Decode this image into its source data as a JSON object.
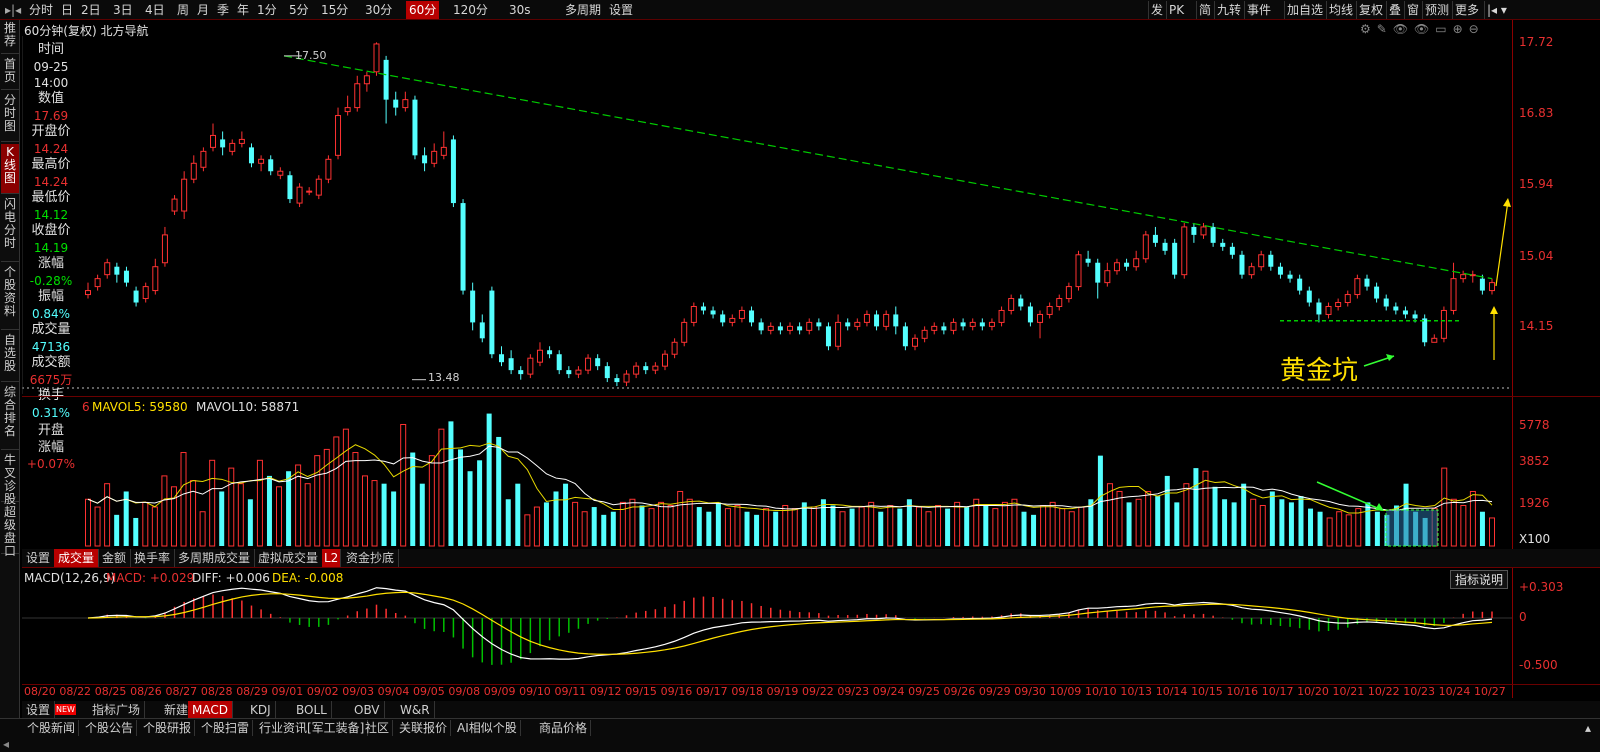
{
  "toolbar": {
    "periods": [
      "分时",
      "日",
      "2日",
      "3日",
      "4日",
      "周",
      "月",
      "季",
      "年",
      "1分",
      "5分",
      "15分",
      "30分",
      "60分",
      "120分",
      "30s",
      "多周期",
      "设置"
    ],
    "selected_period": "60分",
    "right_buttons": [
      "发",
      "PK",
      "简",
      "九转",
      "事件",
      "加自选",
      "均线",
      "复权",
      "叠",
      "窗",
      "预测",
      "更多"
    ]
  },
  "sidebar": {
    "tabs": [
      "推荐",
      "首页",
      "分时图",
      "K线图",
      "闪电分时",
      "个股资料",
      "自选股",
      "综合排名",
      "牛叉诊股",
      "超级盘口"
    ],
    "selected": "K线图"
  },
  "chart_title": "60分钟(复权)  北方导航",
  "info_panel": [
    {
      "label": "时间",
      "value": "09-25"
    },
    {
      "label": "",
      "value": "14:00"
    },
    {
      "label": "数值",
      "value": "17.69"
    },
    {
      "label": "开盘价",
      "value": "14.24"
    },
    {
      "label": "最高价",
      "value": "14.24"
    },
    {
      "label": "最低价",
      "value": "14.12"
    },
    {
      "label": "收盘价",
      "value": "14.19"
    },
    {
      "label": "涨幅",
      "value": "-0.28%"
    },
    {
      "label": "振幅",
      "value": "0.84%"
    },
    {
      "label": "成交量",
      "value": "47136"
    },
    {
      "label": "成交额",
      "value": "6675万"
    },
    {
      "label": "换手",
      "value": "0.31%"
    },
    {
      "label": "开盘涨幅",
      "value": "+0.07%"
    }
  ],
  "price_axis": [
    "17.72",
    "16.83",
    "15.94",
    "15.04",
    "14.15"
  ],
  "annotations": {
    "high": "17.50",
    "low": "13.48",
    "pattern_label": "黄金坑"
  },
  "volume": {
    "legend_prefix": "6",
    "mavol5": "MAVOL5: 59580",
    "mavol10": "MAVOL10: 58871",
    "axis": [
      "5778",
      "3852",
      "1926",
      "X100"
    ],
    "tabs": [
      "设置",
      "成交量",
      "金额",
      "换手率",
      "多周期成交量",
      "虚拟成交量",
      "L2",
      "资金抄底"
    ],
    "selected_tab": "成交量"
  },
  "macd": {
    "name": "MACD(12,26,9)",
    "macd": "MACD: +0.029",
    "diff": "DIFF: +0.006",
    "dea": "DEA: -0.008",
    "axis": [
      "+0.303",
      "0",
      "-0.500"
    ],
    "help": "指标说明"
  },
  "dates": [
    "08/20",
    "08/22",
    "08/25",
    "08/26",
    "08/27",
    "08/28",
    "08/29",
    "09/01",
    "09/02",
    "09/03",
    "09/04",
    "09/05",
    "09/08",
    "09/09",
    "09/10",
    "09/11",
    "09/12",
    "09/15",
    "09/16",
    "09/17",
    "09/18",
    "09/19",
    "09/22",
    "09/23",
    "09/24",
    "09/25",
    "09/26",
    "09/29",
    "09/30",
    "10/09",
    "10/10",
    "10/13",
    "10/14",
    "10/15",
    "10/16",
    "10/17",
    "10/20",
    "10/21",
    "10/22",
    "10/23",
    "10/24",
    "10/27"
  ],
  "indicator_tabs": [
    "设置",
    "指标广场",
    "新建",
    "MACD",
    "KDJ",
    "BOLL",
    "OBV",
    "W&R"
  ],
  "indicator_new_badge": "NEW",
  "indicator_selected": "MACD",
  "footer_tabs": [
    "个股新闻",
    "个股公告",
    "个股研报",
    "个股扫雷",
    "行业资讯[军工装备]",
    "社区",
    "关联报价",
    "AI相似个股",
    "商品价格"
  ],
  "colors": {
    "up": "#ff3232",
    "down": "#54ffff",
    "trend": "#00cc00",
    "pattern": "#ffe000",
    "ma_white": "#ffffff",
    "ma_yellow": "#e6d800",
    "axis": "#e83030"
  },
  "chart_data": {
    "type": "candlestick",
    "interval": "60分",
    "ylim": [
      13.3,
      17.8
    ],
    "y_ticks": [
      17.72,
      16.83,
      15.94,
      15.04,
      14.15
    ],
    "candles": [
      [
        14.55,
        14.6,
        14.7,
        14.5
      ],
      [
        14.65,
        14.75,
        14.8,
        14.6
      ],
      [
        14.8,
        14.95,
        15.0,
        14.75
      ],
      [
        14.9,
        14.8,
        14.95,
        14.7
      ],
      [
        14.85,
        14.7,
        14.9,
        14.65
      ],
      [
        14.6,
        14.45,
        14.65,
        14.4
      ],
      [
        14.5,
        14.65,
        14.7,
        14.45
      ],
      [
        14.6,
        14.9,
        15.0,
        14.55
      ],
      [
        14.95,
        15.3,
        15.4,
        14.9
      ],
      [
        15.6,
        15.75,
        15.8,
        15.55
      ],
      [
        15.6,
        16.0,
        16.1,
        15.5
      ],
      [
        16.0,
        16.2,
        16.3,
        15.95
      ],
      [
        16.15,
        16.35,
        16.4,
        16.1
      ],
      [
        16.4,
        16.55,
        16.7,
        16.35
      ],
      [
        16.5,
        16.4,
        16.6,
        16.3
      ],
      [
        16.35,
        16.45,
        16.5,
        16.3
      ],
      [
        16.45,
        16.5,
        16.6,
        16.4
      ],
      [
        16.4,
        16.2,
        16.45,
        16.15
      ],
      [
        16.2,
        16.25,
        16.3,
        16.1
      ],
      [
        16.25,
        16.1,
        16.3,
        16.05
      ],
      [
        16.05,
        16.1,
        16.15,
        16.0
      ],
      [
        16.05,
        15.75,
        16.1,
        15.7
      ],
      [
        15.7,
        15.9,
        15.95,
        15.65
      ],
      [
        15.85,
        15.85,
        15.9,
        15.8
      ],
      [
        15.8,
        16.0,
        16.05,
        15.75
      ],
      [
        16.0,
        16.25,
        16.3,
        15.95
      ],
      [
        16.3,
        16.8,
        16.9,
        16.25
      ],
      [
        16.85,
        16.9,
        17.05,
        16.8
      ],
      [
        16.9,
        17.2,
        17.3,
        16.85
      ],
      [
        17.2,
        17.3,
        17.35,
        17.1
      ],
      [
        17.35,
        17.7,
        17.72,
        17.3
      ],
      [
        17.5,
        17.0,
        17.55,
        16.7
      ],
      [
        17.0,
        16.9,
        17.1,
        16.8
      ],
      [
        16.9,
        17.0,
        17.1,
        16.85
      ],
      [
        17.0,
        16.3,
        17.05,
        16.25
      ],
      [
        16.3,
        16.2,
        16.4,
        16.1
      ],
      [
        16.2,
        16.35,
        16.45,
        16.15
      ],
      [
        16.3,
        16.4,
        16.6,
        16.25
      ],
      [
        16.5,
        15.7,
        16.55,
        15.65
      ],
      [
        15.7,
        14.6,
        15.75,
        14.55
      ],
      [
        14.6,
        14.2,
        14.7,
        14.1
      ],
      [
        14.2,
        14.0,
        14.3,
        13.95
      ],
      [
        14.6,
        13.8,
        14.65,
        13.75
      ],
      [
        13.8,
        13.7,
        13.9,
        13.65
      ],
      [
        13.75,
        13.6,
        13.85,
        13.55
      ],
      [
        13.6,
        13.55,
        13.65,
        13.48
      ],
      [
        13.55,
        13.75,
        13.8,
        13.5
      ],
      [
        13.7,
        13.85,
        13.95,
        13.65
      ],
      [
        13.85,
        13.8,
        13.9,
        13.75
      ],
      [
        13.8,
        13.6,
        13.85,
        13.55
      ],
      [
        13.6,
        13.55,
        13.65,
        13.5
      ],
      [
        13.55,
        13.6,
        13.65,
        13.5
      ],
      [
        13.6,
        13.75,
        13.8,
        13.55
      ],
      [
        13.75,
        13.65,
        13.8,
        13.6
      ],
      [
        13.65,
        13.5,
        13.7,
        13.45
      ],
      [
        13.5,
        13.45,
        13.55,
        13.4
      ],
      [
        13.45,
        13.55,
        13.6,
        13.4
      ],
      [
        13.55,
        13.65,
        13.7,
        13.5
      ],
      [
        13.65,
        13.6,
        13.7,
        13.55
      ],
      [
        13.6,
        13.65,
        13.7,
        13.55
      ],
      [
        13.65,
        13.8,
        13.85,
        13.6
      ],
      [
        13.8,
        13.95,
        14.0,
        13.75
      ],
      [
        13.95,
        14.2,
        14.25,
        13.9
      ],
      [
        14.2,
        14.4,
        14.45,
        14.15
      ],
      [
        14.4,
        14.35,
        14.45,
        14.3
      ],
      [
        14.35,
        14.3,
        14.4,
        14.25
      ],
      [
        14.3,
        14.2,
        14.35,
        14.15
      ],
      [
        14.2,
        14.25,
        14.3,
        14.15
      ],
      [
        14.25,
        14.35,
        14.4,
        14.2
      ],
      [
        14.35,
        14.2,
        14.4,
        14.15
      ],
      [
        14.2,
        14.1,
        14.25,
        14.05
      ],
      [
        14.1,
        14.15,
        14.2,
        14.05
      ],
      [
        14.15,
        14.1,
        14.2,
        14.05
      ],
      [
        14.1,
        14.15,
        14.2,
        14.05
      ],
      [
        14.15,
        14.1,
        14.2,
        14.05
      ],
      [
        14.1,
        14.2,
        14.25,
        14.05
      ],
      [
        14.2,
        14.15,
        14.25,
        14.1
      ],
      [
        14.15,
        13.9,
        14.2,
        13.85
      ],
      [
        13.9,
        14.2,
        14.3,
        13.85
      ],
      [
        14.2,
        14.15,
        14.25,
        14.1
      ],
      [
        14.15,
        14.2,
        14.25,
        14.1
      ],
      [
        14.2,
        14.3,
        14.35,
        14.15
      ],
      [
        14.3,
        14.15,
        14.35,
        14.1
      ],
      [
        14.15,
        14.3,
        14.35,
        14.1
      ],
      [
        14.3,
        14.15,
        14.4,
        14.05
      ],
      [
        14.15,
        13.9,
        14.2,
        13.85
      ],
      [
        13.9,
        14.0,
        14.05,
        13.85
      ],
      [
        14.0,
        14.1,
        14.15,
        13.95
      ],
      [
        14.1,
        14.15,
        14.2,
        14.05
      ],
      [
        14.15,
        14.1,
        14.2,
        14.05
      ],
      [
        14.1,
        14.2,
        14.25,
        14.05
      ],
      [
        14.2,
        14.15,
        14.25,
        14.1
      ],
      [
        14.15,
        14.2,
        14.25,
        14.1
      ],
      [
        14.2,
        14.15,
        14.25,
        14.1
      ],
      [
        14.15,
        14.2,
        14.25,
        14.1
      ],
      [
        14.2,
        14.35,
        14.4,
        14.15
      ],
      [
        14.35,
        14.5,
        14.55,
        14.3
      ],
      [
        14.5,
        14.4,
        14.55,
        14.35
      ],
      [
        14.4,
        14.2,
        14.45,
        14.15
      ],
      [
        14.2,
        14.3,
        14.35,
        14.0
      ],
      [
        14.3,
        14.4,
        14.45,
        14.25
      ],
      [
        14.4,
        14.5,
        14.55,
        14.35
      ],
      [
        14.5,
        14.65,
        14.7,
        14.45
      ],
      [
        14.65,
        15.05,
        15.1,
        14.6
      ],
      [
        15.0,
        14.95,
        15.1,
        14.9
      ],
      [
        14.95,
        14.7,
        15.0,
        14.5
      ],
      [
        14.7,
        14.85,
        14.95,
        14.65
      ],
      [
        14.85,
        14.95,
        15.0,
        14.8
      ],
      [
        14.95,
        14.9,
        15.0,
        14.85
      ],
      [
        14.9,
        15.0,
        15.1,
        14.85
      ],
      [
        15.0,
        15.3,
        15.35,
        14.95
      ],
      [
        15.3,
        15.2,
        15.4,
        15.15
      ],
      [
        15.2,
        15.1,
        15.25,
        15.05
      ],
      [
        15.2,
        14.8,
        15.25,
        14.75
      ],
      [
        14.8,
        15.4,
        15.45,
        14.75
      ],
      [
        15.4,
        15.3,
        15.45,
        15.2
      ],
      [
        15.3,
        15.4,
        15.45,
        15.25
      ],
      [
        15.4,
        15.2,
        15.45,
        15.15
      ],
      [
        15.2,
        15.15,
        15.25,
        15.1
      ],
      [
        15.15,
        15.05,
        15.2,
        15.0
      ],
      [
        15.05,
        14.8,
        15.1,
        14.75
      ],
      [
        14.8,
        14.9,
        14.95,
        14.75
      ],
      [
        14.9,
        15.05,
        15.1,
        14.85
      ],
      [
        15.05,
        14.9,
        15.1,
        14.85
      ],
      [
        14.9,
        14.8,
        14.95,
        14.75
      ],
      [
        14.8,
        14.75,
        14.85,
        14.7
      ],
      [
        14.75,
        14.6,
        14.8,
        14.55
      ],
      [
        14.6,
        14.45,
        14.65,
        14.4
      ],
      [
        14.45,
        14.3,
        14.5,
        14.2
      ],
      [
        14.3,
        14.4,
        14.45,
        14.25
      ],
      [
        14.4,
        14.45,
        14.5,
        14.35
      ],
      [
        14.45,
        14.55,
        14.6,
        14.4
      ],
      [
        14.55,
        14.75,
        14.8,
        14.5
      ],
      [
        14.75,
        14.65,
        14.8,
        14.6
      ],
      [
        14.65,
        14.5,
        14.7,
        14.45
      ],
      [
        14.5,
        14.4,
        14.55,
        14.35
      ],
      [
        14.4,
        14.35,
        14.45,
        14.3
      ],
      [
        14.35,
        14.3,
        14.4,
        14.25
      ],
      [
        14.3,
        14.25,
        14.35,
        14.2
      ],
      [
        14.25,
        13.95,
        14.3,
        13.9
      ],
      [
        13.95,
        14.0,
        14.05,
        13.95
      ],
      [
        14.0,
        14.35,
        14.4,
        13.95
      ],
      [
        14.35,
        14.75,
        14.95,
        14.3
      ],
      [
        14.75,
        14.8,
        14.85,
        14.7
      ],
      [
        14.8,
        14.8,
        14.85,
        14.7
      ],
      [
        14.75,
        14.6,
        14.8,
        14.55
      ],
      [
        14.6,
        14.7,
        14.75,
        14.55
      ]
    ],
    "volumes": [
      30,
      25,
      40,
      20,
      35,
      18,
      28,
      25,
      45,
      38,
      60,
      42,
      22,
      55,
      35,
      50,
      40,
      30,
      55,
      45,
      38,
      48,
      52,
      40,
      58,
      62,
      70,
      75,
      60,
      45,
      42,
      40,
      35,
      78,
      60,
      40,
      58,
      75,
      80,
      62,
      48,
      55,
      85,
      70,
      30,
      40,
      20,
      25,
      28,
      35,
      40,
      28,
      22,
      25,
      20,
      22,
      28,
      30,
      26,
      24,
      28,
      26,
      35,
      30,
      25,
      22,
      28,
      24,
      26,
      22,
      20,
      24,
      22,
      26,
      24,
      28,
      25,
      30,
      26,
      22,
      24,
      25,
      28,
      22,
      26,
      24,
      30,
      25,
      22,
      26,
      24,
      28,
      25,
      30,
      26,
      24,
      28,
      30,
      22,
      20,
      26,
      28,
      24,
      22,
      25,
      30,
      58,
      40,
      35,
      28,
      30,
      35,
      32,
      45,
      28,
      40,
      50,
      48,
      38,
      30,
      28,
      40,
      30,
      26,
      35,
      30,
      28,
      32,
      24,
      22,
      18,
      22,
      20,
      24,
      28,
      22,
      20,
      26,
      40,
      22,
      18,
      24,
      50,
      30,
      26,
      35,
      22,
      18
    ],
    "ma5": [],
    "macd_hist": []
  }
}
